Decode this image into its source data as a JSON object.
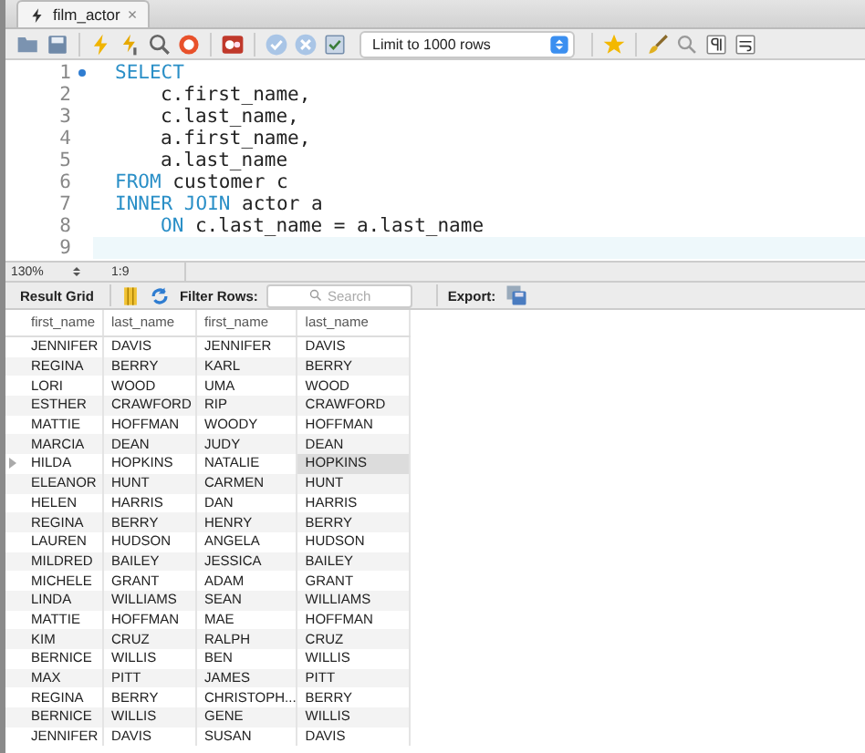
{
  "tab": {
    "title": "film_actor",
    "close": "×"
  },
  "toolbar": {
    "limit": "Limit to 1000 rows"
  },
  "editor": {
    "lines": [
      {
        "number": "1",
        "marker": true,
        "current": false,
        "indented": false,
        "tokens": [
          {
            "kind": "keyword",
            "text": "SELECT"
          }
        ]
      },
      {
        "number": "2",
        "marker": false,
        "current": false,
        "indented": true,
        "tokens": [
          {
            "kind": "text",
            "text": "c.first_name,"
          }
        ]
      },
      {
        "number": "3",
        "marker": false,
        "current": false,
        "indented": true,
        "tokens": [
          {
            "kind": "text",
            "text": "c.last_name,"
          }
        ]
      },
      {
        "number": "4",
        "marker": false,
        "current": false,
        "indented": true,
        "tokens": [
          {
            "kind": "text",
            "text": "a.first_name,"
          }
        ]
      },
      {
        "number": "5",
        "marker": false,
        "current": false,
        "indented": true,
        "tokens": [
          {
            "kind": "text",
            "text": "a.last_name"
          }
        ]
      },
      {
        "number": "6",
        "marker": false,
        "current": false,
        "indented": false,
        "tokens": [
          {
            "kind": "keyword",
            "text": "FROM"
          },
          {
            "kind": "text",
            "text": " customer c"
          }
        ]
      },
      {
        "number": "7",
        "marker": false,
        "current": false,
        "indented": false,
        "tokens": [
          {
            "kind": "keyword",
            "text": "INNER JOIN"
          },
          {
            "kind": "text",
            "text": " actor a"
          }
        ]
      },
      {
        "number": "8",
        "marker": false,
        "current": false,
        "indented": true,
        "tokens": [
          {
            "kind": "keyword",
            "text": "ON"
          },
          {
            "kind": "text",
            "text": " c.last_name = a.last_name"
          }
        ]
      },
      {
        "number": "9",
        "marker": false,
        "current": true,
        "indented": false
      }
    ]
  },
  "status": {
    "zoom": "130%",
    "position": "1:9"
  },
  "result_toolbar": {
    "title": "Result Grid",
    "filter_label": "Filter Rows:",
    "search_placeholder": "Search",
    "export_label": "Export:"
  },
  "grid": {
    "columns": [
      "first_name",
      "last_name",
      "first_name",
      "last_name"
    ],
    "rows": [
      {
        "selected": false,
        "cells": [
          {
            "text": "JENNIFER",
            "selected": false
          },
          {
            "text": "DAVIS",
            "selected": false
          },
          {
            "text": "JENNIFER",
            "selected": false
          },
          {
            "text": "DAVIS",
            "selected": false
          }
        ]
      },
      {
        "selected": false,
        "cells": [
          {
            "text": "REGINA",
            "selected": false
          },
          {
            "text": "BERRY",
            "selected": false
          },
          {
            "text": "KARL",
            "selected": false
          },
          {
            "text": "BERRY",
            "selected": false
          }
        ]
      },
      {
        "selected": false,
        "cells": [
          {
            "text": "LORI",
            "selected": false
          },
          {
            "text": "WOOD",
            "selected": false
          },
          {
            "text": "UMA",
            "selected": false
          },
          {
            "text": "WOOD",
            "selected": false
          }
        ]
      },
      {
        "selected": false,
        "cells": [
          {
            "text": "ESTHER",
            "selected": false
          },
          {
            "text": "CRAWFORD",
            "selected": false
          },
          {
            "text": "RIP",
            "selected": false
          },
          {
            "text": "CRAWFORD",
            "selected": false
          }
        ]
      },
      {
        "selected": false,
        "cells": [
          {
            "text": "MATTIE",
            "selected": false
          },
          {
            "text": "HOFFMAN",
            "selected": false
          },
          {
            "text": "WOODY",
            "selected": false
          },
          {
            "text": "HOFFMAN",
            "selected": false
          }
        ]
      },
      {
        "selected": false,
        "cells": [
          {
            "text": "MARCIA",
            "selected": false
          },
          {
            "text": "DEAN",
            "selected": false
          },
          {
            "text": "JUDY",
            "selected": false
          },
          {
            "text": "DEAN",
            "selected": false
          }
        ]
      },
      {
        "selected": true,
        "cells": [
          {
            "text": "HILDA",
            "selected": false
          },
          {
            "text": "HOPKINS",
            "selected": false
          },
          {
            "text": "NATALIE",
            "selected": false
          },
          {
            "text": "HOPKINS",
            "selected": true
          }
        ]
      },
      {
        "selected": false,
        "cells": [
          {
            "text": "ELEANOR",
            "selected": false
          },
          {
            "text": "HUNT",
            "selected": false
          },
          {
            "text": "CARMEN",
            "selected": false
          },
          {
            "text": "HUNT",
            "selected": false
          }
        ]
      },
      {
        "selected": false,
        "cells": [
          {
            "text": "HELEN",
            "selected": false
          },
          {
            "text": "HARRIS",
            "selected": false
          },
          {
            "text": "DAN",
            "selected": false
          },
          {
            "text": "HARRIS",
            "selected": false
          }
        ]
      },
      {
        "selected": false,
        "cells": [
          {
            "text": "REGINA",
            "selected": false
          },
          {
            "text": "BERRY",
            "selected": false
          },
          {
            "text": "HENRY",
            "selected": false
          },
          {
            "text": "BERRY",
            "selected": false
          }
        ]
      },
      {
        "selected": false,
        "cells": [
          {
            "text": "LAUREN",
            "selected": false
          },
          {
            "text": "HUDSON",
            "selected": false
          },
          {
            "text": "ANGELA",
            "selected": false
          },
          {
            "text": "HUDSON",
            "selected": false
          }
        ]
      },
      {
        "selected": false,
        "cells": [
          {
            "text": "MILDRED",
            "selected": false
          },
          {
            "text": "BAILEY",
            "selected": false
          },
          {
            "text": "JESSICA",
            "selected": false
          },
          {
            "text": "BAILEY",
            "selected": false
          }
        ]
      },
      {
        "selected": false,
        "cells": [
          {
            "text": "MICHELE",
            "selected": false
          },
          {
            "text": "GRANT",
            "selected": false
          },
          {
            "text": "ADAM",
            "selected": false
          },
          {
            "text": "GRANT",
            "selected": false
          }
        ]
      },
      {
        "selected": false,
        "cells": [
          {
            "text": "LINDA",
            "selected": false
          },
          {
            "text": "WILLIAMS",
            "selected": false
          },
          {
            "text": "SEAN",
            "selected": false
          },
          {
            "text": "WILLIAMS",
            "selected": false
          }
        ]
      },
      {
        "selected": false,
        "cells": [
          {
            "text": "MATTIE",
            "selected": false
          },
          {
            "text": "HOFFMAN",
            "selected": false
          },
          {
            "text": "MAE",
            "selected": false
          },
          {
            "text": "HOFFMAN",
            "selected": false
          }
        ]
      },
      {
        "selected": false,
        "cells": [
          {
            "text": "KIM",
            "selected": false
          },
          {
            "text": "CRUZ",
            "selected": false
          },
          {
            "text": "RALPH",
            "selected": false
          },
          {
            "text": "CRUZ",
            "selected": false
          }
        ]
      },
      {
        "selected": false,
        "cells": [
          {
            "text": "BERNICE",
            "selected": false
          },
          {
            "text": "WILLIS",
            "selected": false
          },
          {
            "text": "BEN",
            "selected": false
          },
          {
            "text": "WILLIS",
            "selected": false
          }
        ]
      },
      {
        "selected": false,
        "cells": [
          {
            "text": "MAX",
            "selected": false
          },
          {
            "text": "PITT",
            "selected": false
          },
          {
            "text": "JAMES",
            "selected": false
          },
          {
            "text": "PITT",
            "selected": false
          }
        ]
      },
      {
        "selected": false,
        "cells": [
          {
            "text": "REGINA",
            "selected": false
          },
          {
            "text": "BERRY",
            "selected": false
          },
          {
            "text": "CHRISTOPH...",
            "selected": false
          },
          {
            "text": "BERRY",
            "selected": false
          }
        ]
      },
      {
        "selected": false,
        "cells": [
          {
            "text": "BERNICE",
            "selected": false
          },
          {
            "text": "WILLIS",
            "selected": false
          },
          {
            "text": "GENE",
            "selected": false
          },
          {
            "text": "WILLIS",
            "selected": false
          }
        ]
      },
      {
        "selected": false,
        "cells": [
          {
            "text": "JENNIFER",
            "selected": false
          },
          {
            "text": "DAVIS",
            "selected": false
          },
          {
            "text": "SUSAN",
            "selected": false
          },
          {
            "text": "DAVIS",
            "selected": false
          }
        ]
      }
    ]
  }
}
